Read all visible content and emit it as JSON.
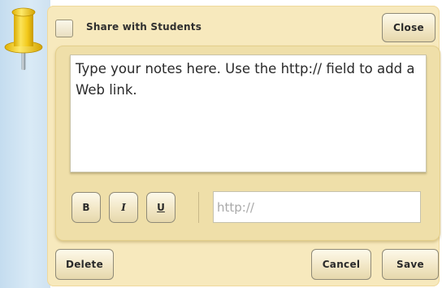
{
  "header": {
    "share_label": "Share with Students",
    "share_checked": false,
    "close_label": "Close"
  },
  "editor": {
    "notes_text": "Type your notes here. Use the http:// field to add a Web link."
  },
  "format_toolbar": {
    "bold_label": "B",
    "italic_label": "I",
    "underline_label": "U"
  },
  "link": {
    "placeholder": "http://",
    "value": ""
  },
  "footer": {
    "delete_label": "Delete",
    "cancel_label": "Cancel",
    "save_label": "Save"
  },
  "icons": {
    "pin": "pushpin-icon"
  },
  "colors": {
    "panel": "#f7e9bd",
    "inner_panel": "#efdfa9",
    "pin_yellow": "#f5cf1d",
    "side_strip": "#cfe2f1"
  }
}
